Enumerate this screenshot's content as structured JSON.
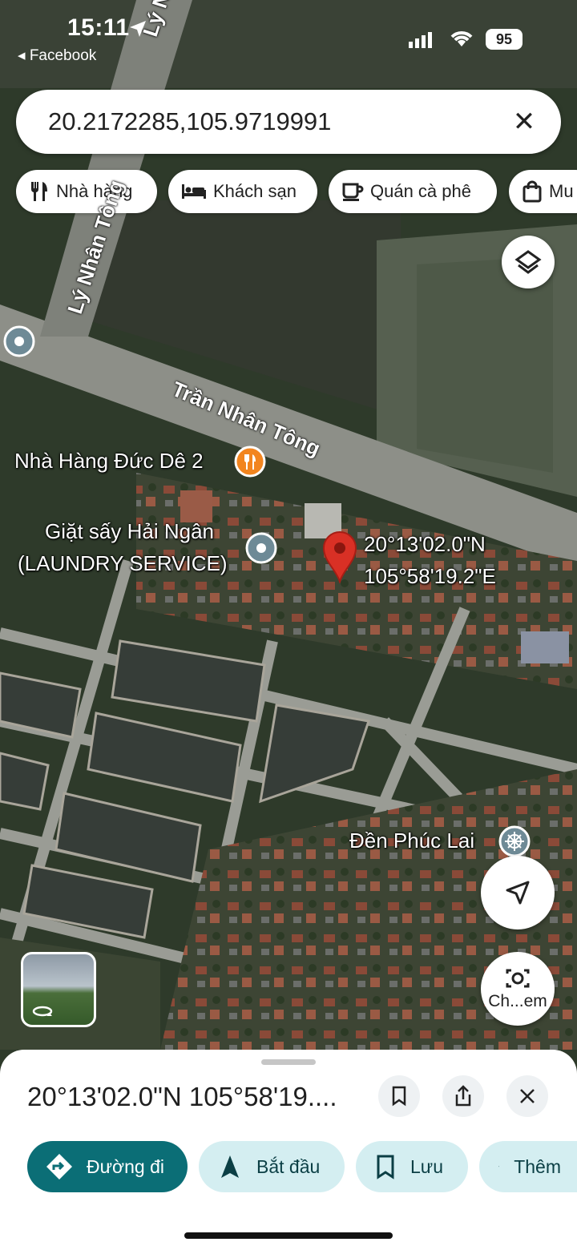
{
  "status_bar": {
    "time": "15:11",
    "back_app": "◂ Facebook",
    "battery": "95"
  },
  "search": {
    "value": "20.2172285,105.9719991"
  },
  "chips": [
    {
      "label": "Nhà hàng",
      "icon": "fork-knife-icon"
    },
    {
      "label": "Khách sạn",
      "icon": "bed-icon"
    },
    {
      "label": "Quán cà phê",
      "icon": "coffee-icon"
    },
    {
      "label": "Mu",
      "icon": "shopping-bag-icon"
    }
  ],
  "map": {
    "roads": [
      "Lý Nhân",
      "Lý Nhân Tông",
      "Trần Nhân Tông"
    ],
    "places": [
      {
        "name": "Nhà Hàng Đức Dê 2",
        "icon": "restaurant-pin-icon"
      },
      {
        "name_line1": "Giặt sấy Hải Ngân",
        "name_line2": "(LAUNDRY SERVICE)",
        "icon": "place-pin-icon"
      },
      {
        "name": "Đền Phúc Lai",
        "icon": "temple-pin-icon"
      }
    ],
    "pin_coords": {
      "lat": "20°13'02.0\"N",
      "lng": "105°58'19.2\"E"
    },
    "camera_button_label": "Ch...em",
    "colors": {
      "pin": "#d93025",
      "accent": "#0b6e76"
    }
  },
  "sheet": {
    "title": "20°13'02.0\"N 105°58'19....",
    "actions": [
      {
        "label": "Đường đi",
        "icon": "directions-icon"
      },
      {
        "label": "Bắt đầu",
        "icon": "navigate-icon"
      },
      {
        "label": "Lưu",
        "icon": "bookmark-icon"
      },
      {
        "label": "Thêm",
        "icon": "flag-icon"
      }
    ]
  }
}
